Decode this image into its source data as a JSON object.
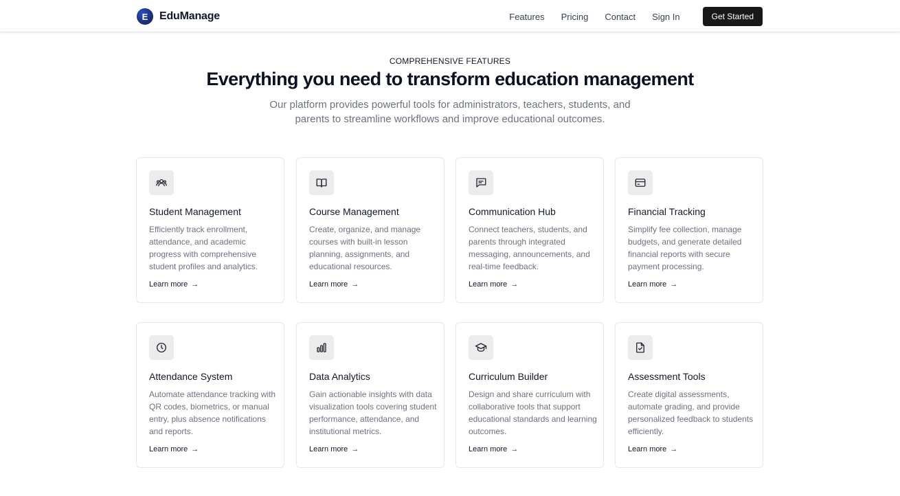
{
  "header": {
    "brand_initial": "E",
    "brand_name": "EduManage",
    "nav": [
      "Features",
      "Pricing",
      "Contact",
      "Sign In"
    ],
    "cta": "Get Started"
  },
  "hero": {
    "eyebrow": "COMPREHENSIVE FEATURES",
    "title": "Everything you need to transform education management",
    "subtitle": "Our platform provides powerful tools for administrators, teachers, students, and parents to streamline workflows and improve educational outcomes."
  },
  "link_arrow": "→",
  "features": [
    {
      "icon": "users-icon",
      "title": "Student Management",
      "description": "Efficiently track enrollment, attendance, and academic progress with comprehensive student profiles and analytics.",
      "link": "Learn more"
    },
    {
      "icon": "book-open-icon",
      "title": "Course Management",
      "description": "Create, organize, and manage courses with built-in lesson planning, assignments, and educational resources.",
      "link": "Learn more"
    },
    {
      "icon": "message-square-icon",
      "title": "Communication Hub",
      "description": "Connect teachers, students, and parents through integrated messaging, announcements, and real-time feedback.",
      "link": "Learn more"
    },
    {
      "icon": "credit-card-icon",
      "title": "Financial Tracking",
      "description": "Simplify fee collection, manage budgets, and generate detailed financial reports with secure payment processing.",
      "link": "Learn more"
    },
    {
      "icon": "clock-icon",
      "title": "Attendance System",
      "description": "Automate attendance tracking with QR codes, biometrics, or manual entry, plus absence notifications and reports.",
      "link": "Learn more"
    },
    {
      "icon": "bar-chart-icon",
      "title": "Data Analytics",
      "description": "Gain actionable insights with data visualization tools covering student performance, attendance, and institutional metrics.",
      "link": "Learn more"
    },
    {
      "icon": "graduation-cap-icon",
      "title": "Curriculum Builder",
      "description": "Design and share curriculum with collaborative tools that support educational standards and learning outcomes.",
      "link": "Learn more"
    },
    {
      "icon": "file-check-icon",
      "title": "Assessment Tools",
      "description": "Create digital assessments, automate grading, and provide personalized feedback to students efficiently.",
      "link": "Learn more"
    }
  ]
}
